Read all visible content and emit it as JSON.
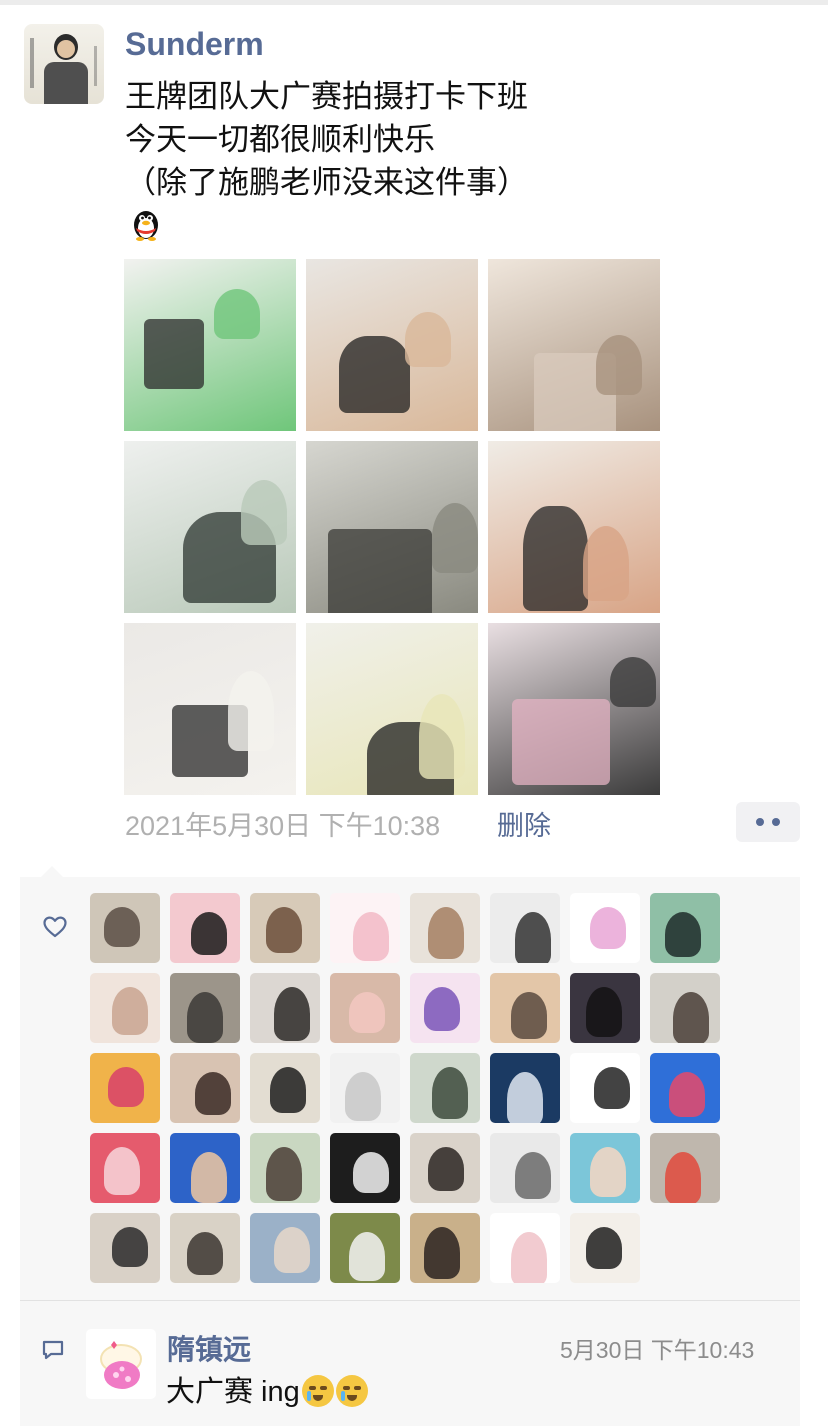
{
  "post": {
    "author": "Sunderm",
    "text_lines": [
      "王牌团队大广赛拍摄打卡下班",
      "今天一切都很顺利快乐",
      "（除了施鹏老师没来这件事）"
    ],
    "sticker": "penguin-emoji",
    "timestamp": "2021年5月30日 下午10:38",
    "delete_label": "删除",
    "photos": [
      {
        "name": "photo-camera-gear",
        "colors": [
          "#f2f2f0",
          "#2b2b2b",
          "#6fc67a"
        ]
      },
      {
        "name": "photo-people-with-camera",
        "colors": [
          "#e9e6e2",
          "#1f1f1f",
          "#d9b89a"
        ]
      },
      {
        "name": "photo-room-interior",
        "colors": [
          "#efe6dc",
          "#d9cbbd",
          "#a8927e"
        ]
      },
      {
        "name": "photo-person-window",
        "colors": [
          "#eef0ee",
          "#2c3530",
          "#b9c9b9"
        ]
      },
      {
        "name": "photo-subway-blur",
        "colors": [
          "#d6d6d0",
          "#3a3a36",
          "#8a8a80"
        ]
      },
      {
        "name": "photo-group-selfie",
        "colors": [
          "#f0ece6",
          "#262626",
          "#d8a486"
        ]
      },
      {
        "name": "photo-dinner-table",
        "colors": [
          "#ebe9e6",
          "#2a2a2a",
          "#f4f2ee"
        ]
      },
      {
        "name": "photo-bedroom-window",
        "colors": [
          "#f0f0ea",
          "#1e1e1e",
          "#e8e6b8"
        ]
      },
      {
        "name": "photo-pink-subway",
        "colors": [
          "#e9dfe2",
          "#e4b3c3",
          "#3b3b3b"
        ]
      }
    ]
  },
  "likes": {
    "icon": "heart-outline-icon",
    "avatars": [
      {
        "name": "liker-1",
        "colors": [
          "#cfc6b8",
          "#5a4e44"
        ]
      },
      {
        "name": "liker-2",
        "colors": [
          "#f3c9cf",
          "#1a1a1a"
        ]
      },
      {
        "name": "liker-3",
        "colors": [
          "#d7cab8",
          "#6c4f3a"
        ]
      },
      {
        "name": "liker-4",
        "colors": [
          "#fdf3f5",
          "#f2b8c6"
        ]
      },
      {
        "name": "liker-5",
        "colors": [
          "#e8e2da",
          "#a57f61"
        ]
      },
      {
        "name": "liker-6",
        "colors": [
          "#ececec",
          "#333333"
        ]
      },
      {
        "name": "liker-7",
        "colors": [
          "#ffffff",
          "#e9a6d6"
        ]
      },
      {
        "name": "liker-8",
        "colors": [
          "#8fbfa6",
          "#1e2b2a"
        ]
      },
      {
        "name": "liker-9",
        "colors": [
          "#f0e4dc",
          "#c9a490"
        ]
      },
      {
        "name": "liker-10",
        "colors": [
          "#9c958a",
          "#3c3a36"
        ]
      },
      {
        "name": "liker-11",
        "colors": [
          "#dcd7d2",
          "#2d2a28"
        ]
      },
      {
        "name": "liker-12",
        "colors": [
          "#d8b9a8",
          "#f3c7c1"
        ]
      },
      {
        "name": "liker-13",
        "colors": [
          "#f5e3f0",
          "#7a55b8"
        ]
      },
      {
        "name": "liker-14",
        "colors": [
          "#e3c6a8",
          "#5b4a40"
        ]
      },
      {
        "name": "liker-15",
        "colors": [
          "#3a3540",
          "#141214"
        ]
      },
      {
        "name": "liker-16",
        "colors": [
          "#d3d0c9",
          "#4a3f38"
        ]
      },
      {
        "name": "liker-17",
        "colors": [
          "#f0b34a",
          "#d8406a"
        ]
      },
      {
        "name": "liker-18",
        "colors": [
          "#d8c3b2",
          "#3b2a24"
        ]
      },
      {
        "name": "liker-19",
        "colors": [
          "#e3ddd2",
          "#1f1f1f"
        ]
      },
      {
        "name": "liker-20",
        "colors": [
          "#f1f1f1",
          "#c8c8c8"
        ]
      },
      {
        "name": "liker-21",
        "colors": [
          "#cfd8cc",
          "#3d4b3c"
        ]
      },
      {
        "name": "liker-22",
        "colors": [
          "#1b3a63",
          "#dfe7f1"
        ]
      },
      {
        "name": "liker-23",
        "colors": [
          "#ffffff",
          "#222222"
        ]
      },
      {
        "name": "liker-24",
        "colors": [
          "#2f6fd8",
          "#e54a6b"
        ]
      },
      {
        "name": "liker-25",
        "colors": [
          "#e55b6d",
          "#f7d6da"
        ]
      },
      {
        "name": "liker-26",
        "colors": [
          "#2d63c8",
          "#f0c7a0"
        ]
      },
      {
        "name": "liker-27",
        "colors": [
          "#c9d7c1",
          "#4b3e36"
        ]
      },
      {
        "name": "liker-28",
        "colors": [
          "#1d1d1d",
          "#f2f2f2"
        ]
      },
      {
        "name": "liker-29",
        "colors": [
          "#dad3ca",
          "#2b2623"
        ]
      },
      {
        "name": "liker-30",
        "colors": [
          "#e9e9e9",
          "#6a6a6a"
        ]
      },
      {
        "name": "liker-31",
        "colors": [
          "#7cc6d9",
          "#f6d6c2"
        ]
      },
      {
        "name": "liker-32",
        "colors": [
          "#bfb7ad",
          "#e04a3c"
        ]
      },
      {
        "name": "liker-33",
        "colors": [
          "#d9d1c7",
          "#2a2a2a"
        ]
      },
      {
        "name": "liker-34",
        "colors": [
          "#d9d2c6",
          "#3b3630"
        ]
      },
      {
        "name": "liker-35",
        "colors": [
          "#9bb1c8",
          "#e7d8c9"
        ]
      },
      {
        "name": "liker-36",
        "colors": [
          "#7d8a4a",
          "#f2f2f2"
        ]
      },
      {
        "name": "liker-37",
        "colors": [
          "#c9b08a",
          "#2b2320"
        ]
      },
      {
        "name": "liker-38",
        "colors": [
          "#ffffff",
          "#f0c2c8"
        ]
      },
      {
        "name": "liker-39",
        "colors": [
          "#f3efe9",
          "#1f1f1f"
        ]
      }
    ]
  },
  "comment": {
    "icon": "comment-bubble-icon",
    "author": "隋镇远",
    "time": "5月30日 下午10:43",
    "text": "大广赛 ing",
    "emojis": [
      "crying-face-emoji",
      "crying-face-emoji"
    ]
  },
  "ui": {
    "link_color": "#576b95",
    "panel_bg": "#f7f7f7"
  }
}
